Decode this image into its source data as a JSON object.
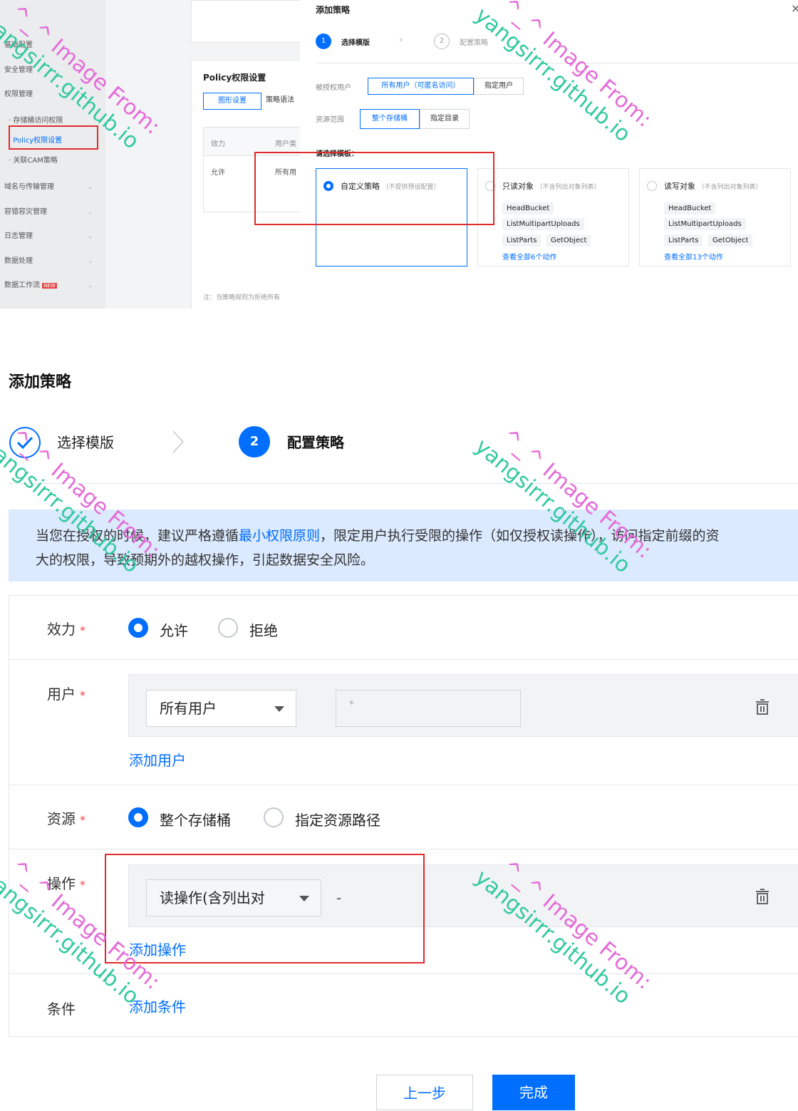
{
  "top": {
    "sidebar": {
      "items": [
        {
          "label": "基础配置"
        },
        {
          "label": "安全管理"
        },
        {
          "label": "权限管理"
        },
        {
          "label": "域名与传输管理"
        },
        {
          "label": "容错容灾管理"
        },
        {
          "label": "日志管理"
        },
        {
          "label": "数据处理"
        },
        {
          "label": "数据工作流"
        }
      ],
      "sub_items": [
        {
          "label": "存储桶访问权限"
        },
        {
          "label": "Policy权限设置"
        },
        {
          "label": "关联CAM策略"
        }
      ],
      "new_badge": "NEW"
    },
    "panel": {
      "title": "Policy权限设置",
      "tab_graphic": "图形设置",
      "tab_code": "策略语法",
      "col_effect": "效力",
      "col_user": "用户类",
      "row_effect": "允许",
      "row_user": "所有用",
      "note": "注：当策略规则为拒绝所有"
    },
    "dialog": {
      "title": "添加策略",
      "close": "×",
      "step1_num": "1",
      "step1_label": "选择模版",
      "step2_num": "2",
      "step2_label": "配置策略",
      "grantee_label": "被授权用户",
      "grantee_all": "所有用户（可匿名访问）",
      "grantee_specific": "指定用户",
      "scope_label": "资源范围",
      "scope_bucket": "整个存储桶",
      "scope_dir": "指定目录",
      "template_heading": "请选择模板：",
      "templates": [
        {
          "title": "自定义策略",
          "note": "（不提供预设配置）",
          "tags": [],
          "link": ""
        },
        {
          "title": "只读对象",
          "note": "（不含列出对象列表）",
          "tags": [
            "HeadBucket",
            "ListMultipartUploads",
            "ListParts",
            "GetObject"
          ],
          "link": "查看全部6个动作"
        },
        {
          "title": "读写对象",
          "note": "（不含列出对象列表）",
          "tags": [
            "HeadBucket",
            "ListMultipartUploads",
            "ListParts",
            "GetObject"
          ],
          "link": "查看全部13个动作"
        }
      ]
    }
  },
  "bottom": {
    "title": "添加策略",
    "step1_label": "选择模版",
    "step2_num": "2",
    "step2_label": "配置策略",
    "notice_a": "当您在授权的时候，建议严格遵循",
    "notice_link": "最小权限原则",
    "notice_b": "，限定用户执行受限的操作（如仅授权读操作），访问指定前缀的资",
    "notice_line2": "大的权限，导致预期外的越权操作，引起数据安全风险。",
    "effect_label": "效力",
    "effect_allow": "允许",
    "effect_deny": "拒绝",
    "user_label": "用户",
    "user_select": "所有用户",
    "user_input_placeholder": "*",
    "add_user": "添加用户",
    "resource_label": "资源",
    "resource_bucket": "整个存储桶",
    "resource_path": "指定资源路径",
    "action_label": "操作",
    "action_select": "读操作(含列出对",
    "action_dash": "-",
    "add_action": "添加操作",
    "condition_label": "条件",
    "add_condition": "添加条件",
    "btn_prev": "上一步",
    "btn_done": "完成",
    "required_mark": "*"
  },
  "watermark": {
    "line1": "^_^ Image From:",
    "line2": "yangsirrr.github.io"
  },
  "colors": {
    "accent": "#006eff",
    "highlight_red": "#e02b2b",
    "notice_bg": "#dceaff"
  }
}
